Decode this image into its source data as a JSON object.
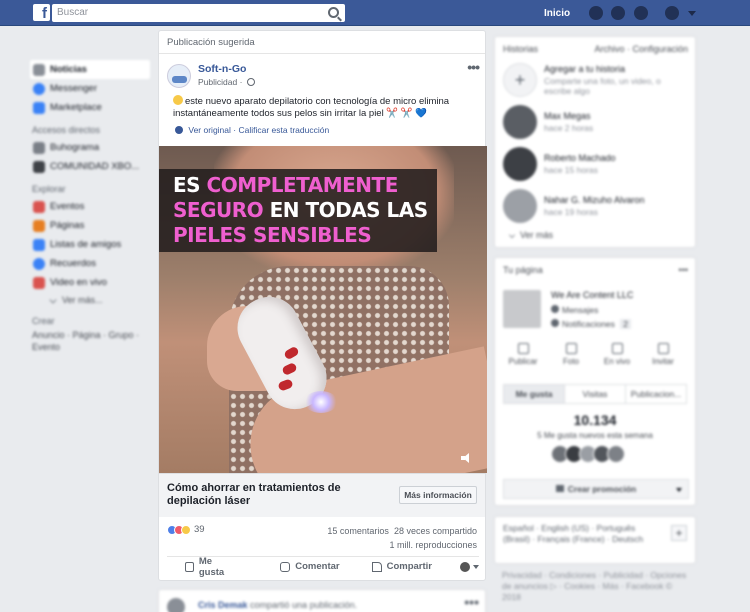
{
  "topbar": {
    "search_placeholder": "Buscar",
    "home_label": "Inicio"
  },
  "leftnav": {
    "items": [
      {
        "label": "Noticias",
        "icon": "newsfeed-icon",
        "color": "#8a8f97"
      },
      {
        "label": "Messenger",
        "icon": "messenger-icon",
        "color": "#3b82f6"
      },
      {
        "label": "Marketplace",
        "icon": "marketplace-icon",
        "color": "#3b82f6"
      }
    ],
    "shortcuts_title": "Accesos directos",
    "shortcuts": [
      {
        "label": "Buhograma",
        "icon": "group-icon",
        "color": "#7a7f87"
      },
      {
        "label": "COMUNIDAD XBO...",
        "icon": "group-icon",
        "color": "#3f4247"
      }
    ],
    "explore_title": "Explorar",
    "explore": [
      {
        "label": "Eventos",
        "icon": "calendar-icon",
        "color": "#d9534f"
      },
      {
        "label": "Páginas",
        "icon": "flag-icon",
        "color": "#e67e22"
      },
      {
        "label": "Listas de amigos",
        "icon": "friends-list-icon",
        "color": "#3b82f6"
      },
      {
        "label": "Recuerdos",
        "icon": "memories-icon",
        "color": "#3b82f6"
      },
      {
        "label": "Video en vivo",
        "icon": "live-video-icon",
        "color": "#d9534f"
      }
    ],
    "see_more": "Ver más...",
    "create_title": "Crear",
    "create_links": "Anuncio · Página · Grupo · Evento"
  },
  "post": {
    "suggested_label": "Publicación sugerida",
    "page_name": "Soft-n-Go",
    "sponsored": "Publicidad",
    "text": "este nuevo aparato depilatorio con tecnología de micro elimina instantáneamente todos sus pelos sin irritar la piel",
    "text_emojis": "✂️ ✂️ 💙",
    "translate_original": "Ver original",
    "translate_rate": "Calificar esta traducción",
    "video_caption": {
      "line1_a": "ES ",
      "line1_b": "COMPLETAMENTE",
      "line2_a": "SEGURO",
      "line2_b": " EN TODAS LAS",
      "line3": "PIELES SENSIBLES"
    },
    "cta_title": "Cómo ahorrar en tratamientos de depilación láser",
    "cta_button": "Más información",
    "reaction_count": "39",
    "comments": "15 comentarios",
    "shares": "28 veces compartido",
    "views": "1 mill. reproducciones",
    "actions": {
      "like": "Me gusta",
      "comment": "Comentar",
      "share": "Compartir"
    }
  },
  "post2": {
    "author": "Cris Demak",
    "text": " compartió una publicación."
  },
  "stories": {
    "title": "Historias",
    "archive": "Archivo",
    "settings": "Configuración",
    "add_title": "Agregar a tu historia",
    "add_sub": "Comparte una foto, un video, o escribe algo",
    "items": [
      {
        "name": "Max Megas",
        "time": "hace 2 horas"
      },
      {
        "name": "Roberto Machado",
        "time": "hace 15 horas"
      },
      {
        "name": "Nahar G. Mizuho Alvaron",
        "time": "hace 19 horas"
      }
    ],
    "see_more": "Ver más"
  },
  "your_page": {
    "title": "Tu página",
    "name": "We Are Content LLC",
    "messages": "Mensajes",
    "notifications": "Notificaciones",
    "notif_count": "2",
    "quick": [
      "Publicar",
      "Foto",
      "En vivo",
      "Invitar"
    ],
    "tabs": [
      "Me gusta",
      "Visitas",
      "Publicacion..."
    ],
    "likes_number": "10.134",
    "likes_caption": "5 Me gusta nuevos esta semana",
    "promote": "Crear promoción"
  },
  "languages": {
    "text": "Español · English (US) · Português (Brasil) · Français (France) · Deutsch"
  },
  "footer": {
    "text": "Privacidad · Condiciones · Publicidad · Opciones de anuncios ▷ · Cookies · Más · Facebook © 2018"
  }
}
